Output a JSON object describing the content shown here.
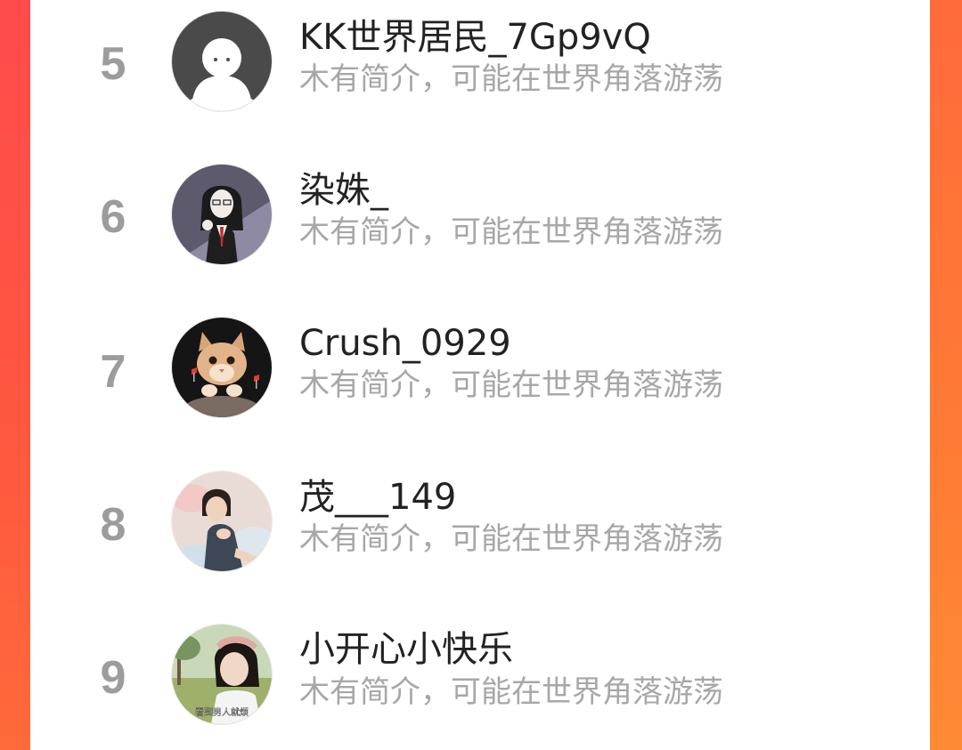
{
  "theme": {
    "frame_accent": "#ff5a3c",
    "rank_color": "#9c9c9c",
    "name_color": "#222222",
    "bio_color": "#a7a7a7"
  },
  "leaderboard": {
    "rows": [
      {
        "rank": "5",
        "name": "KK世界居民_7Gp9vQ",
        "bio": "木有简介，可能在世界角落游荡",
        "avatar_icon": "default-user-avatar"
      },
      {
        "rank": "6",
        "name": "染姝_",
        "bio": "木有简介，可能在世界角落游荡",
        "avatar_icon": "anime-girl-avatar"
      },
      {
        "rank": "7",
        "name": "Crush_0929",
        "bio": "木有简介，可能在世界角落游荡",
        "avatar_icon": "cat-avatar"
      },
      {
        "rank": "8",
        "name": "茂___149",
        "bio": "木有简介，可能在世界角落游荡",
        "avatar_icon": "child-photo-avatar"
      },
      {
        "rank": "9",
        "name": "小开心小快乐",
        "bio": "木有简介，可能在世界角落游荡",
        "avatar_icon": "girl-photo-avatar",
        "avatar_caption": "看到男人就烦"
      }
    ]
  }
}
